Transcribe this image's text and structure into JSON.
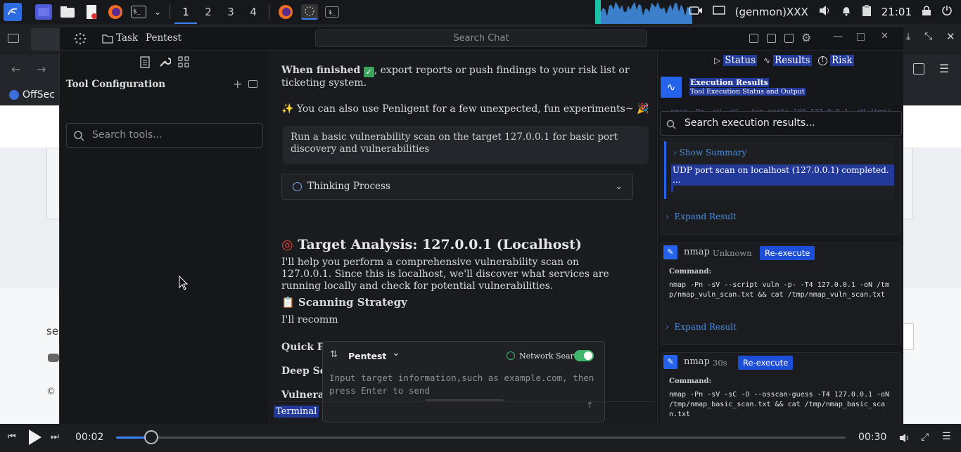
{
  "taskbar": {
    "workspaces": [
      "1",
      "2",
      "3",
      "4"
    ],
    "active_workspace_index": 0,
    "genmon": "(genmon)XXX",
    "clock": "21:01"
  },
  "browser": {
    "tab_label": "OffSec",
    "bg_text_1": "se",
    "bg_text_2": "©"
  },
  "app": {
    "menu": {
      "task": "Task",
      "pentest": "Pentest"
    },
    "search_chat_placeholder": "Search Chat",
    "tool_config": {
      "title": "Tool Configuration",
      "search_placeholder": "Search tools..."
    },
    "chat": {
      "line_finished": ", export reports or push findings to your risk list or ticketing system.",
      "line_finished_bold": "When finished",
      "line_fun": "You can also use Penligent for a few unexpected, fun experiments~",
      "user_message": "Run a basic vulnerability scan on the target 127.0.0.1 for basic port discovery and vulnerabilities",
      "thinking_label": "Thinking Process",
      "heading": "Target Analysis: 127.0.0.1 (Localhost)",
      "para": "I'll help you perform a comprehensive vulnerability scan on 127.0.0.1. Since this is localhost, we'll discover what services are running locally and check for potential vulnerabilities.",
      "subheading": "Scanning Strategy",
      "partial_recommend": "I'll recomm",
      "bold_1": "Quick Por",
      "bold_2": "Deep Serv",
      "bold_3": "Vulnerabi"
    },
    "composer": {
      "mode": "Pentest",
      "network_search_label": "Network Search",
      "network_search_on": true,
      "placeholder": "Input target information,such as example.com, then press Enter to send"
    },
    "terminal_tab": "Terminal",
    "results": {
      "tabs": [
        "Status",
        "Results",
        "Risk"
      ],
      "header_title": "Execution Results",
      "header_subtitle": "Tool Execution Status and Output",
      "faded_command": "nmap -Pn -sU -sV --top-ports 100 127.0.0.1 -oN /tmp/",
      "search_placeholder": "Search execution results...",
      "summary_toggle": "Show Summary",
      "summary_text": "UDP port scan on localhost (127.0.0.1) completed. ...",
      "expand_label": "Expand Result",
      "command_label": "Command:",
      "reexecute_label": "Re-execute",
      "cards": [
        {
          "tool": "nmap",
          "status": "Unknown",
          "command": "nmap -Pn -sV --script vuln -p- -T4 127.0.0.1 -oN /tm\np/nmap_vuln_scan.txt && cat /tmp/nmap_vuln_scan.txt"
        },
        {
          "tool": "nmap",
          "status": "30s",
          "command": "nmap -Pn -sV -sC -O --osscan-guess -T4 127.0.0.1 -oN\n/tmp/nmap_basic_scan.txt && cat /tmp/nmap_basic_sca\nn.txt"
        }
      ]
    }
  },
  "player": {
    "current_time": "00:02",
    "total_time": "00:30",
    "progress_fraction": 0.048
  },
  "colors": {
    "accent": "#3b82f6",
    "selection": "#243a9a",
    "reexecute": "#1d4ed8"
  }
}
